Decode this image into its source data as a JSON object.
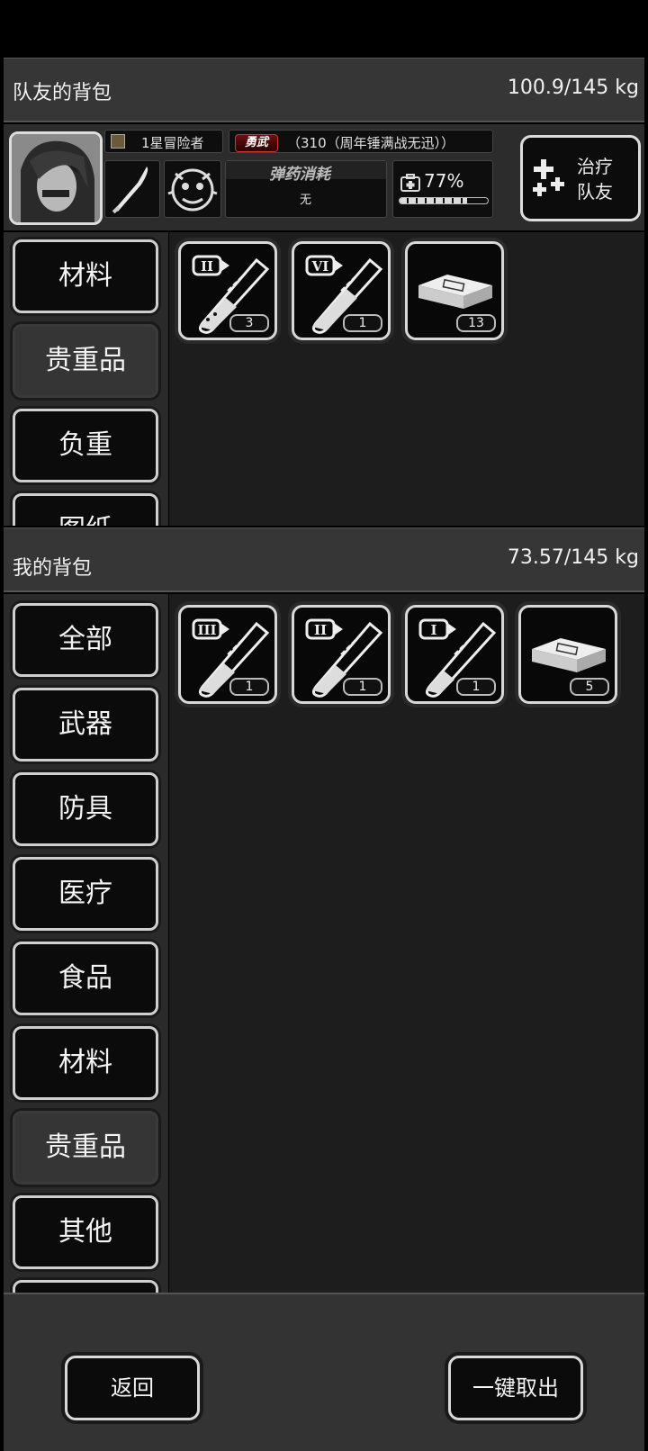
{
  "teammate_bag": {
    "title": "队友的背包",
    "weight": "100.9/145 kg",
    "rank": "1星冒险者",
    "trait_tag": "勇武",
    "trait_desc": "（310（周年锤满战无迅））",
    "ammo_label": "弹药消耗",
    "ammo_value": "无",
    "health_percent_text": "77%",
    "health_fraction": 0.77,
    "heal_button_line1": "治疗",
    "heal_button_line2": "队友",
    "categories": [
      {
        "label": "材料",
        "active": false
      },
      {
        "label": "贵重品",
        "active": true
      },
      {
        "label": "负重",
        "active": false
      },
      {
        "label": "图纸",
        "active": false
      }
    ],
    "items": [
      {
        "icon": "test-tube-icon",
        "tier": "II",
        "qty": "3"
      },
      {
        "icon": "test-tube-icon",
        "tier": "VI",
        "qty": "1"
      },
      {
        "icon": "cash-stack-icon",
        "tier": "",
        "qty": "13"
      }
    ]
  },
  "my_bag": {
    "title": "我的背包",
    "weight": "73.57/145 kg",
    "categories": [
      {
        "label": "全部",
        "active": false
      },
      {
        "label": "武器",
        "active": false
      },
      {
        "label": "防具",
        "active": false
      },
      {
        "label": "医疗",
        "active": false
      },
      {
        "label": "食品",
        "active": false
      },
      {
        "label": "材料",
        "active": false
      },
      {
        "label": "贵重品",
        "active": true
      },
      {
        "label": "其他",
        "active": false
      }
    ],
    "items": [
      {
        "icon": "test-tube-icon",
        "tier": "III",
        "qty": "1"
      },
      {
        "icon": "test-tube-icon",
        "tier": "II",
        "qty": "1"
      },
      {
        "icon": "test-tube-icon",
        "tier": "I",
        "qty": "1"
      },
      {
        "icon": "cash-stack-icon",
        "tier": "",
        "qty": "5"
      }
    ]
  },
  "buttons": {
    "back": "返回",
    "take_all": "一键取出"
  }
}
